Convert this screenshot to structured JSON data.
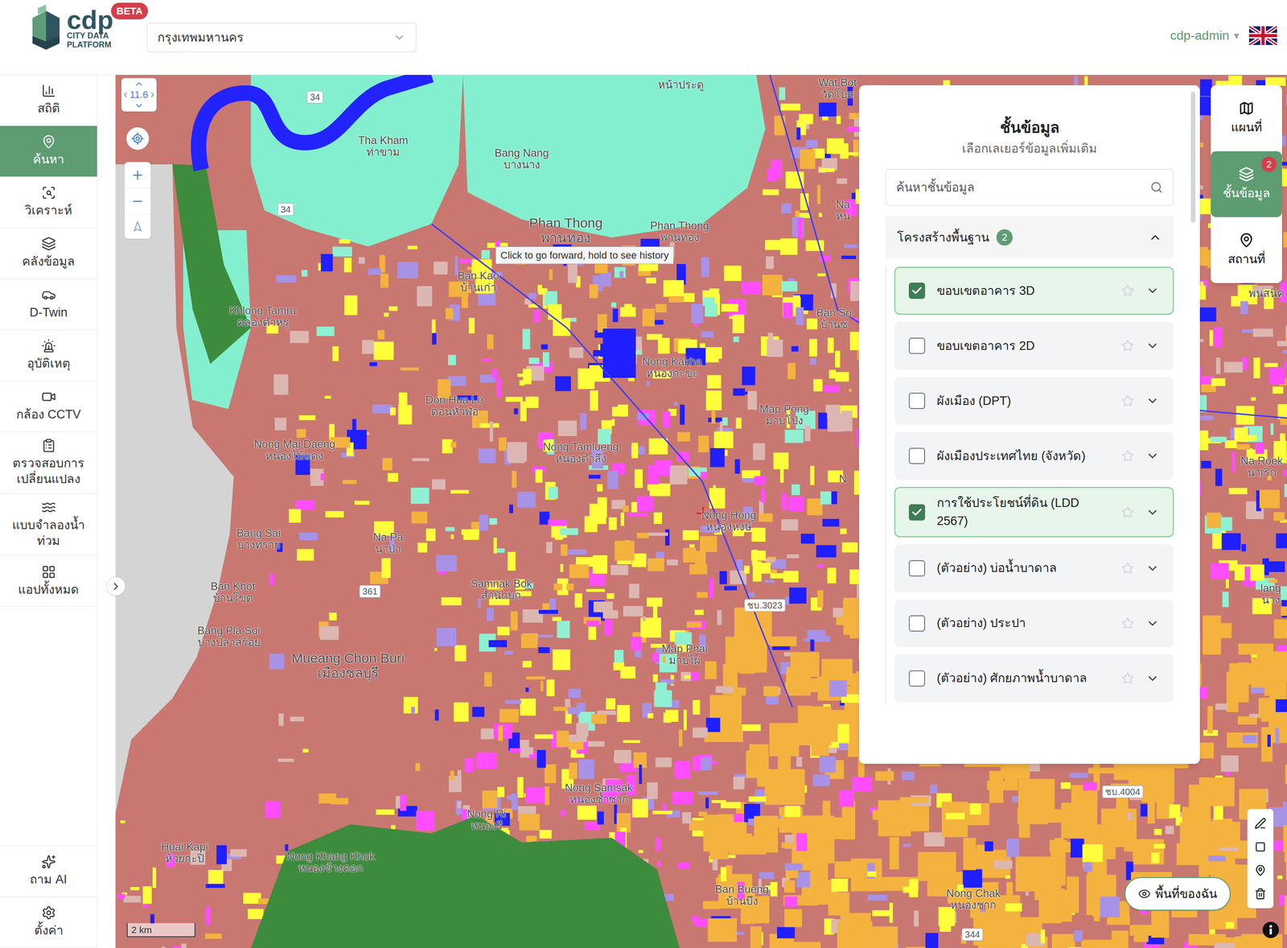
{
  "header": {
    "logo": {
      "name": "cdp",
      "line1": "CITY DATA",
      "line2": "PLATFORM",
      "badge": "BETA"
    },
    "city_select": {
      "value": "กรุงเทพมหานคร"
    },
    "user": "cdp-admin",
    "user_caret": "▾"
  },
  "sidebar": {
    "items": [
      {
        "label": "สถิติ",
        "selected": false
      },
      {
        "label": "ค้นหา",
        "selected": true
      },
      {
        "label": "วิเคราะห์",
        "selected": false
      },
      {
        "label": "คลังข้อมูล",
        "selected": false
      },
      {
        "label": "D-Twin",
        "selected": false
      },
      {
        "label": "อุบัติเหตุ",
        "selected": false
      },
      {
        "label": "กล้อง CCTV",
        "selected": false
      },
      {
        "label": "ตรวจสอบการเปลี่ยนแปลง",
        "selected": false
      },
      {
        "label": "แบบจำลองน้ำท่วม",
        "selected": false
      },
      {
        "label": "แอปทั้งหมด",
        "selected": false
      }
    ],
    "bottom_items": [
      {
        "label": "ถาม AI",
        "selected": false
      },
      {
        "label": "ตั้งค่า",
        "selected": false
      }
    ]
  },
  "map": {
    "zoom": "11.6",
    "tooltip": "Click to go forward, hold to see history",
    "scale": "2 km",
    "places": [
      {
        "lines": [
          "Tha Kham",
          "ท่าขาม"
        ]
      },
      {
        "lines": [
          "Bang Nang",
          "บางนาง"
        ]
      },
      {
        "lines": [
          "Phan Thong",
          "พานทอง"
        ]
      },
      {
        "lines": [
          "Phan Thong",
          "พานทอง"
        ]
      },
      {
        "lines": [
          "Ban Kao",
          "บ้านเก่า"
        ]
      },
      {
        "lines": [
          "Khlong Tamru",
          "คลองตำหรุ"
        ]
      },
      {
        "lines": [
          "Nong Kakha",
          "หนองกะขะ"
        ]
      },
      {
        "lines": [
          "Don Hua Lo",
          "ดอนหัวฬ่อ"
        ]
      },
      {
        "lines": [
          "Map Pong",
          "มาบโป่ง"
        ]
      },
      {
        "lines": [
          "Nong Mai Daeng",
          "หนองไม้แดง"
        ]
      },
      {
        "lines": [
          "Nong Tamlueng",
          "หนองตำลึง"
        ]
      },
      {
        "lines": [
          "Nong Hong",
          "หนองหงษ์"
        ]
      },
      {
        "lines": [
          "Bang Sai",
          "บางทราย"
        ]
      },
      {
        "lines": [
          "Na Pa",
          "นาป่า"
        ]
      },
      {
        "lines": [
          "Ban Khot",
          "บ้านโขด"
        ]
      },
      {
        "lines": [
          "Samnak Bok",
          "สำนักบก"
        ]
      },
      {
        "lines": [
          "Bang Pla Soi",
          "บางปลาสร้อย"
        ]
      },
      {
        "lines": [
          "Mueang Chon Buri",
          "เมืองชลบุรี"
        ]
      },
      {
        "lines": [
          "Map Phai",
          "มาบไผ่"
        ]
      },
      {
        "lines": [
          "Nong Samsak",
          "หนองซ้ำซาก"
        ]
      },
      {
        "lines": [
          "Nong Ri",
          "หนองรี"
        ]
      },
      {
        "lines": [
          "Huai Kapi",
          "ห้วยกะปิ"
        ]
      },
      {
        "lines": [
          "Nong Khang Khok",
          "หนองข้างคอก"
        ]
      },
      {
        "lines": [
          "Ban Bueng",
          "บ้านบึง"
        ]
      },
      {
        "lines": [
          "Nong Chak",
          "หนองชาก"
        ]
      },
      {
        "lines": [
          "Na Roek",
          "นาเริก"
        ]
      },
      {
        "lines": [
          "หน้าประดู"
        ]
      },
      {
        "lines": [
          "Wat Bot",
          "วัดโบส"
        ]
      },
      {
        "lines": [
          "Na",
          "หน"
        ]
      },
      {
        "lines": [
          "Ban So",
          "บ้านซ"
        ]
      },
      {
        "lines": [
          "พนสนิค"
        ]
      },
      {
        "lines": [
          "lang",
          "นาง"
        ]
      },
      {
        "lines": [
          "N"
        ]
      }
    ],
    "road_shields": [
      "34",
      "34",
      "361",
      "ชบ.3023",
      "ชบ.4004",
      "344"
    ]
  },
  "layers_panel": {
    "title": "ชั้นข้อมูล",
    "subtitle": "เลือกเลเยอร์ข้อมูลเพิ่มเติม",
    "search_placeholder": "ค้นหาชั้นข้อมูล",
    "group": {
      "label": "โครงสร้างพื้นฐาน",
      "count": "2",
      "expanded": true
    },
    "layers": [
      {
        "label": "ขอบเขตอาคาร 3D",
        "checked": true
      },
      {
        "label": "ขอบเขตอาคาร 2D",
        "checked": false
      },
      {
        "label": "ผังเมือง (DPT)",
        "checked": false
      },
      {
        "label": "ผังเมืองประเทศไทย (จังหวัด)",
        "checked": false
      },
      {
        "label": "การใช้ประโยชน์ที่ดิน (LDD 2567)",
        "checked": true
      },
      {
        "label": "(ตัวอย่าง) บ่อน้ำบาดาล",
        "checked": false
      },
      {
        "label": "(ตัวอย่าง) ประปา",
        "checked": false
      },
      {
        "label": "(ตัวอย่าง) ศักยภาพน้ำบาดาล",
        "checked": false
      }
    ]
  },
  "right_tabs": [
    {
      "label": "แผนที่",
      "selected": false,
      "badge": ""
    },
    {
      "label": "ชั้นข้อมูล",
      "selected": true,
      "badge": "2"
    },
    {
      "label": "สถานที่",
      "selected": false,
      "badge": ""
    }
  ],
  "my_area_button": "พื้นที่ของฉัน"
}
